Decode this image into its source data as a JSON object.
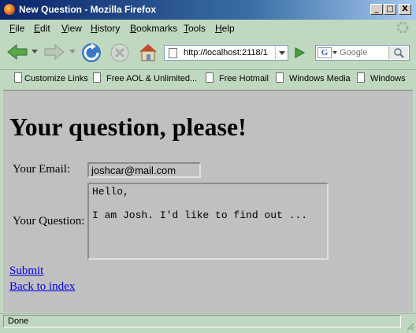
{
  "window": {
    "title": "New Question - Mozilla Firefox",
    "controls": {
      "minimize": "_",
      "maximize": "□",
      "close": "X"
    }
  },
  "menu": [
    "File",
    "Edit",
    "View",
    "History",
    "Bookmarks",
    "Tools",
    "Help"
  ],
  "nav": {
    "url": "http://localhost:2118/1",
    "search_placeholder": "Google"
  },
  "bookmarks": [
    "Customize Links",
    "Free AOL & Unlimited...",
    "Free Hotmail",
    "Windows Media",
    "Windows"
  ],
  "page": {
    "heading": "Your question, please!",
    "email_label": "Your Email:",
    "email_value": "joshcar@mail.com",
    "question_label": "Your Question:",
    "question_value": "Hello,\n\nI am Josh. I'd like to find out ...",
    "submit_link": "Submit",
    "back_link": "Back to index"
  },
  "status": "Done",
  "colors": {
    "titlebar": "#0a246a",
    "chrome": "#c0d8c0",
    "page_bg": "#c0c0c0",
    "link": "#0000ee"
  }
}
